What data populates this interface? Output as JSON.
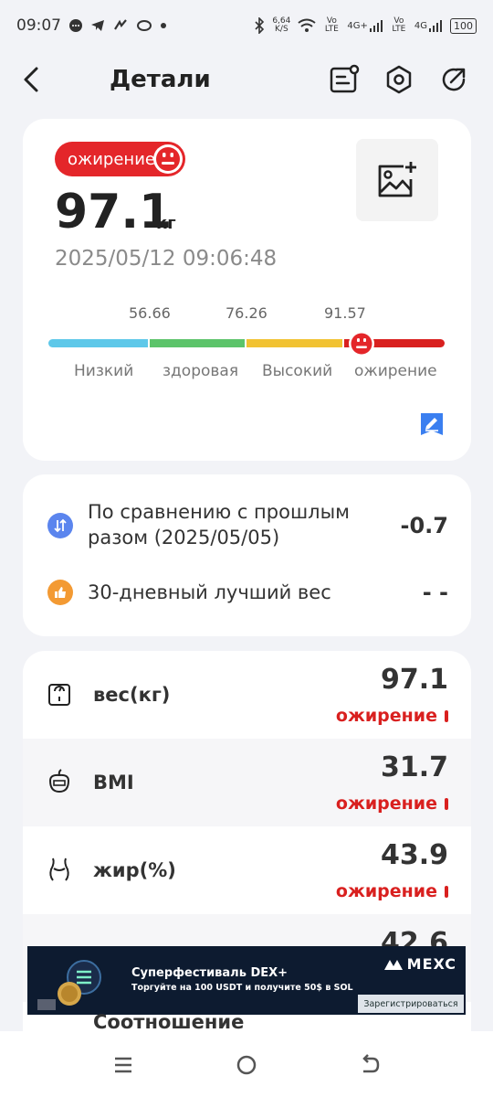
{
  "status_bar": {
    "time": "09:07",
    "speed_value": "6,64",
    "speed_unit": "K/S",
    "volte1": "Vo LTE",
    "net1": "4G+",
    "volte2": "Vo LTE",
    "net2": "4G",
    "battery": "100"
  },
  "header": {
    "title": "Детали"
  },
  "summary": {
    "badge": "ожирение",
    "weight": "97.1",
    "weight_unit": "кг",
    "datetime": "2025/05/12 09:06:48",
    "scale": {
      "thresholds": [
        "56.66",
        "76.26",
        "91.57"
      ],
      "labels": [
        "Низкий",
        "здоровая",
        "Высокий",
        "ожирение"
      ],
      "colors": [
        "#5ec8e9",
        "#5cc46a",
        "#f1c232",
        "#d9201f"
      ],
      "current_category_index": 3
    }
  },
  "comparison": {
    "previous_label": "По сравнению с прошлым разом (2025/05/05)",
    "previous_line1": "По сравнению с прошлым",
    "previous_line2": "разом (2025/05/05)",
    "previous_value": "-0.7",
    "best_label": "30-дневный лучший вес",
    "best_value": "- -"
  },
  "metrics": [
    {
      "icon": "scale-icon",
      "label": "вес(кг)",
      "value": "97.1",
      "status": "ожирение"
    },
    {
      "icon": "bmi-icon",
      "label": "BMI",
      "value": "31.7",
      "status": "ожирение"
    },
    {
      "icon": "body-fat-icon",
      "label": "жир(%)",
      "value": "43.9",
      "status": "ожирение"
    },
    {
      "icon": "ratio-icon",
      "label": "Соотношение",
      "value": "42.6",
      "status": ""
    }
  ],
  "ad": {
    "title": "Суперфестиваль DEX+",
    "subtitle_plain": "Торгуйте на 100 USDT и ",
    "subtitle_highlight": "получите 50$ в SOL",
    "brand": "MEXC",
    "cta": "Зарегистрироваться"
  },
  "colors": {
    "accent_red": "#e4262a",
    "status_red": "#d9201f",
    "page_bg": "#f2f3f7"
  }
}
